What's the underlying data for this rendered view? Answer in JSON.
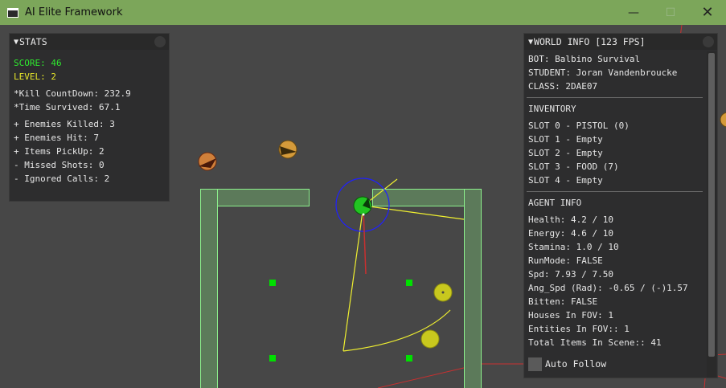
{
  "window": {
    "title": "AI Elite Framework",
    "minimize_glyph": "—",
    "maximize_glyph": "☐",
    "close_glyph": "✕"
  },
  "stats": {
    "header": "STATS",
    "score": "SCORE: 46",
    "level": "LEVEL: 2",
    "kill_countdown": "*Kill CountDown: 232.9",
    "time_survived": "*Time Survived: 67.1",
    "enemies_killed": "+ Enemies Killed: 3",
    "enemies_hit": "+ Enemies Hit: 7",
    "items_pickup": "+ Items PickUp: 2",
    "missed_shots": "- Missed Shots: 0",
    "ignored_calls": "- Ignored Calls: 2"
  },
  "world_info": {
    "header": "WORLD INFO [123 FPS]",
    "bot": "BOT: Balbino Survival",
    "student": "STUDENT: Joran Vandenbroucke",
    "class": "CLASS: 2DAE07",
    "inventory_title": "INVENTORY",
    "slots": [
      "SLOT 0 - PISTOL (0)",
      "SLOT 1 - Empty",
      "SLOT 2 - Empty",
      "SLOT 3 - FOOD (7)",
      "SLOT 4 - Empty"
    ],
    "agent_info_title": "AGENT INFO",
    "agent": [
      "Health: 4.2 / 10",
      "Energy: 4.6 / 10",
      "Stamina: 1.0 / 10",
      "RunMode: FALSE",
      "Spd: 7.93 / 7.50",
      "Ang_Spd (Rad): -0.65 / (-)1.57",
      "Bitten: FALSE",
      "Houses In FOV: 1",
      "Entities In FOV:: 1",
      "Total Items In Scene:: 41"
    ],
    "auto_follow_label": "Auto Follow",
    "auto_follow_checked": false
  },
  "colors": {
    "background": "#474747",
    "titlebar": "#7ca65a",
    "house_fill": "#5c7a5a",
    "house_outline": "#8cf08c",
    "agent": "#22c422",
    "fov": "#f0f030",
    "radius": "#2020ff",
    "enemy": "#d0803a",
    "item": "#c8c81e",
    "nav_point": "#00e000",
    "path": "#c83030"
  }
}
